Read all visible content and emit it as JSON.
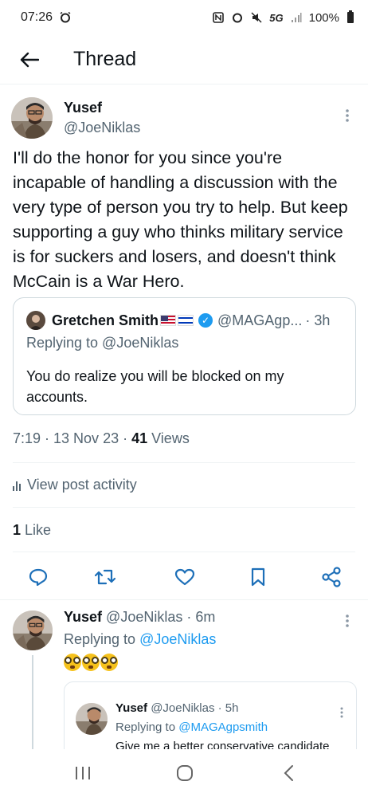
{
  "status_bar": {
    "time": "07:26",
    "network": "5G",
    "battery": "100%",
    "icons": [
      "alarm-icon",
      "nfc-icon",
      "alarm-icon",
      "mute-icon",
      "signal-icon",
      "battery-icon"
    ]
  },
  "header": {
    "title": "Thread",
    "back_icon": "arrow-left-icon"
  },
  "main_tweet": {
    "display_name": "Yusef",
    "handle": "@JoeNiklas",
    "text": "I'll do the honor for you since you're incapable of handling a discussion with the very type of person you try to help. But keep supporting a guy who thinks military service is for suckers and losers, and doesn't think McCain is a War Hero.",
    "quote": {
      "display_name": "Gretchen Smith",
      "handle": "@MAGAgp...",
      "time": "· 3h",
      "replying_to": "Replying to @JoeNiklas",
      "text": "You do realize you will be blocked on my accounts."
    },
    "timestamp": "7:19 · 13 Nov 23 · ",
    "views_count": "41",
    "views_label": " Views",
    "view_activity": "View post activity",
    "likes_count": "1",
    "likes_label": " Like"
  },
  "actions": [
    "reply-icon",
    "repost-icon",
    "like-icon",
    "bookmark-icon",
    "share-icon"
  ],
  "reply": {
    "display_name": "Yusef",
    "handle": "@JoeNiklas · 6m",
    "replying_prefix": "Replying to ",
    "replying_handle": "@JoeNiklas",
    "emoji": [
      "grimacing-goggle-eyes",
      "grimacing-goggle-eyes",
      "grimacing-goggle-eyes"
    ],
    "inner": {
      "display_name": "Yusef",
      "handle": "@JoeNiklas · 5h",
      "replying_prefix": "Replying to ",
      "replying_handle": "@MAGAgpsmith",
      "text": "Give me a better conservative candidate"
    }
  },
  "colors": {
    "accent": "#1d9bf0",
    "text": "#0f1419",
    "secondary": "#536471",
    "border": "#cfd9de"
  }
}
